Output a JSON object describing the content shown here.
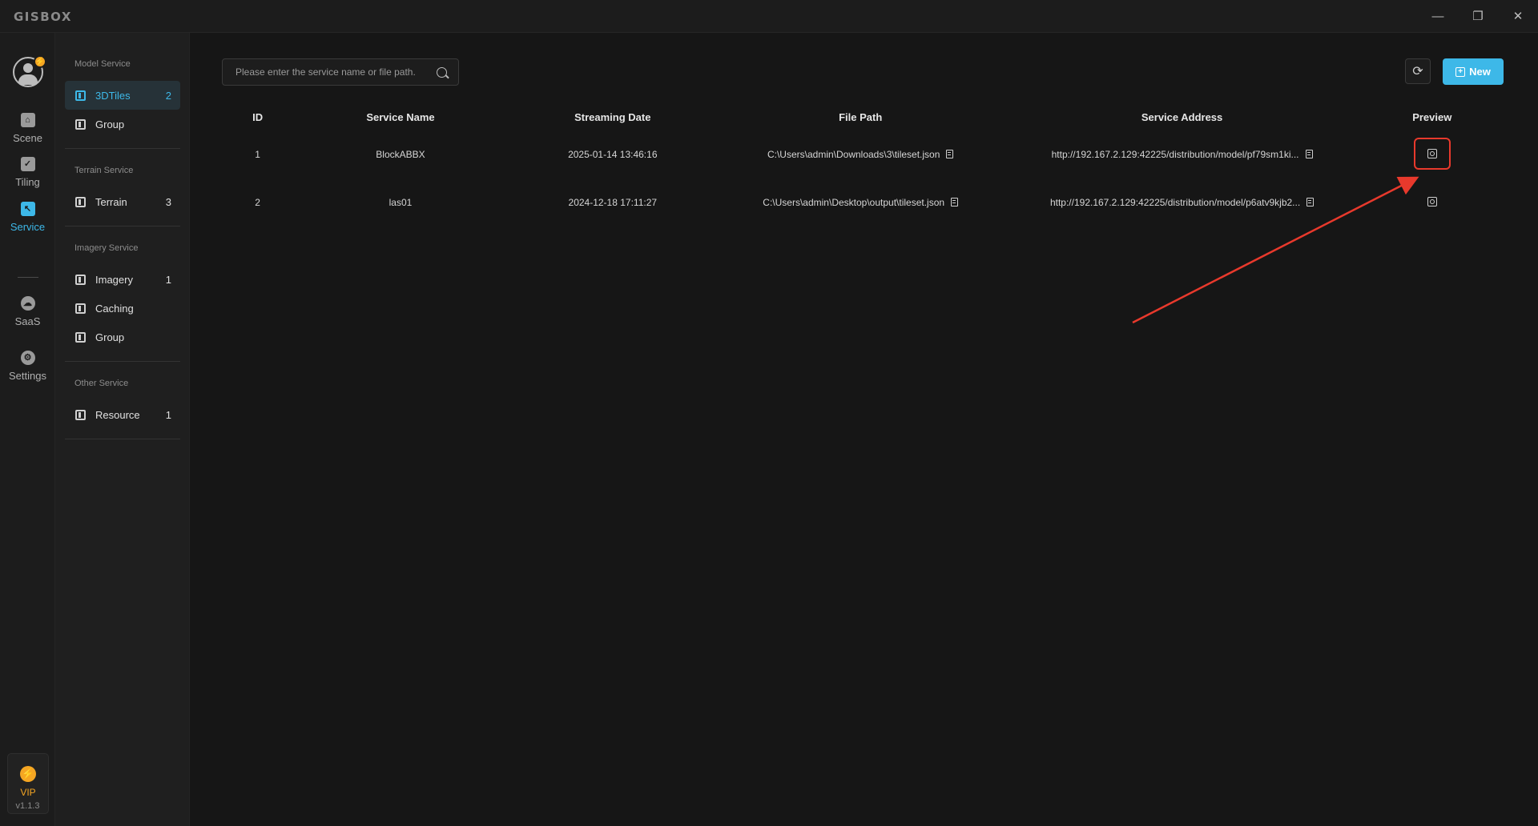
{
  "app": {
    "logo": "GISBOX",
    "version": "v1.1.3"
  },
  "window_controls": {
    "minimize": "—",
    "restore": "❐",
    "close": "✕"
  },
  "rail": {
    "items": [
      {
        "label": "Scene",
        "icon": "scene-icon"
      },
      {
        "label": "Tiling",
        "icon": "tiling-icon"
      },
      {
        "label": "Service",
        "icon": "service-icon",
        "active": true
      },
      {
        "label": "SaaS",
        "icon": "saas-icon"
      },
      {
        "label": "Settings",
        "icon": "settings-icon"
      }
    ],
    "vip": "VIP"
  },
  "services": {
    "model_heading": "Model Service",
    "model_items": [
      {
        "label": "3DTiles",
        "count": "2",
        "active": true
      },
      {
        "label": "Group",
        "count": ""
      }
    ],
    "terrain_heading": "Terrain Service",
    "terrain_items": [
      {
        "label": "Terrain",
        "count": "3"
      }
    ],
    "imagery_heading": "Imagery Service",
    "imagery_items": [
      {
        "label": "Imagery",
        "count": "1"
      },
      {
        "label": "Caching",
        "count": ""
      },
      {
        "label": "Group",
        "count": ""
      }
    ],
    "other_heading": "Other Service",
    "other_items": [
      {
        "label": "Resource",
        "count": "1"
      }
    ]
  },
  "toolbar": {
    "search_placeholder": "Please enter the service name or file path.",
    "new_label": "New"
  },
  "table": {
    "headers": [
      "ID",
      "Service Name",
      "Streaming Date",
      "File Path",
      "Service Address",
      "Preview"
    ],
    "rows": [
      {
        "id": "1",
        "name": "BlockABBX",
        "date": "2025-01-14 13:46:16",
        "path": "C:\\Users\\admin\\Downloads\\3\\tileset.json",
        "address": "http://192.167.2.129:42225/distribution/model/pf79sm1ki...",
        "highlight": true
      },
      {
        "id": "2",
        "name": "las01",
        "date": "2024-12-18 17:11:27",
        "path": "C:\\Users\\admin\\Desktop\\output\\tileset.json",
        "address": "http://192.167.2.129:42225/distribution/model/p6atv9kjb2...",
        "highlight": false
      }
    ]
  },
  "colors": {
    "accent": "#3db8e8",
    "annotation": "#e8392c",
    "vip": "#f5a623"
  }
}
